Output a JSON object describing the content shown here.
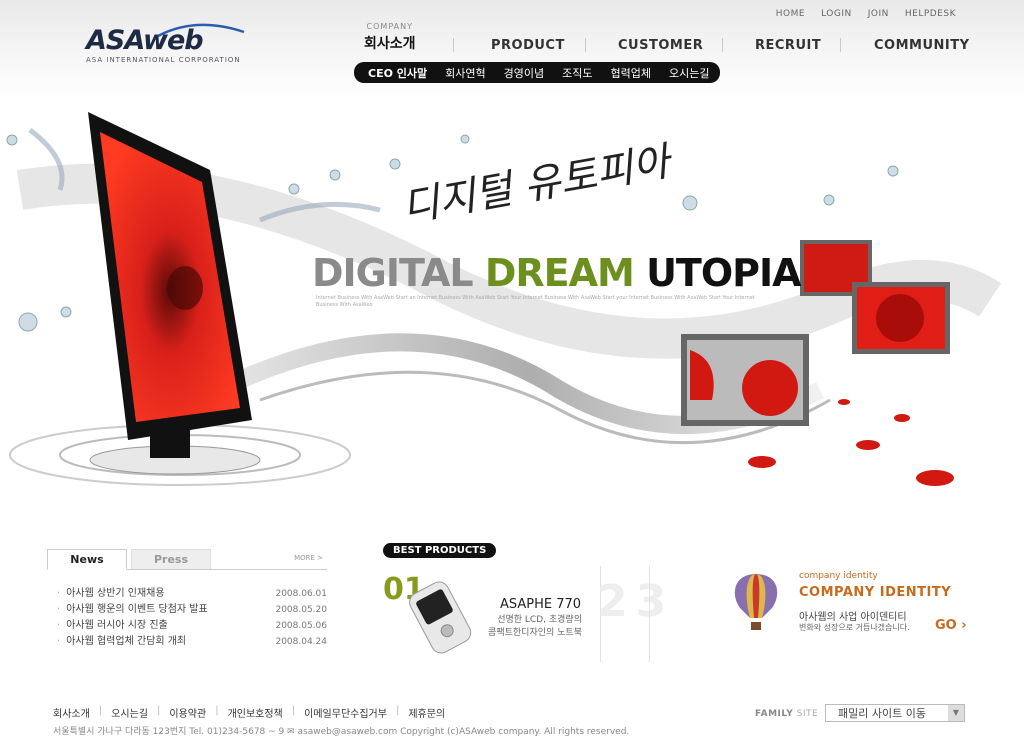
{
  "brand": {
    "logo_text": "ASAweb",
    "logo_sub": "ASA INTERNATIONAL CORPORATION"
  },
  "util_nav": [
    "HOME",
    "LOGIN",
    "JOIN",
    "HELPDESK"
  ],
  "gnb": {
    "company_en": "COMPANY",
    "company_ko": "회사소개",
    "items": [
      "PRODUCT",
      "CUSTOMER",
      "RECRUIT",
      "COMMUNITY"
    ]
  },
  "subnav": [
    "CEO 인사말",
    "회사연혁",
    "경영이념",
    "조직도",
    "협력업체",
    "오시는길"
  ],
  "hero": {
    "script": "디지털 유토피아",
    "title_1": "DIGITAL",
    "title_2": "DREAM",
    "title_3": "UTOPIA",
    "fine": "Internet Business With AsaWeb Start an Internet Business With AsaWeb Start Your Internet Business With AsaWeb Start your Internet Business With AsaWeb Start Your Internet Business With AsaWeb"
  },
  "news": {
    "tab_active": "News",
    "tab_other": "Press",
    "more": "MORE >",
    "items": [
      {
        "title": "아사웹 상반기 인재채용",
        "date": "2008.06.01"
      },
      {
        "title": "아사웹 행운의 이벤트 당첨자 발표",
        "date": "2008.05.20"
      },
      {
        "title": "아사웹 러시아 시장 진출",
        "date": "2008.05.06"
      },
      {
        "title": "아사웹 협력업체 간담회 개최",
        "date": "2008.04.24"
      }
    ]
  },
  "best": {
    "tag_bold": "BEST",
    "tag_rest": " PRODUCTS",
    "num": "01",
    "ghost": "23",
    "name": "ASAPHE 770",
    "desc_1": "선명한 LCD, 초경량의",
    "desc_2": "콤팩트한디자인의 노트북"
  },
  "ci": {
    "small": "company identity",
    "big": "COMPANY IDENTITY",
    "ko_1": "아사웹의 사업 아이덴티티",
    "ko_2": "변화와 성장으로 거듭나겠습니다.",
    "go": "GO"
  },
  "footer": {
    "links": [
      "회사소개",
      "오시는길",
      "이용약관",
      "개인보호정책",
      "이메일무단수집거부",
      "제휴문의"
    ],
    "address": "서울특별시 가나구 다라동 123번지  Tel. 01)234-5678 ~ 9   ✉ asaweb@asaweb.com  Copyright (c)ASAweb company. All rights reserved.",
    "family_label": "FAMILY",
    "family_label2": " SITE",
    "family_value": "패밀리 사이트 이동"
  },
  "colors": {
    "accent_green": "#6d8f1e",
    "accent_orange": "#c86a1c",
    "nav_dark": "#111111",
    "monitor_red": "#d8201a"
  }
}
